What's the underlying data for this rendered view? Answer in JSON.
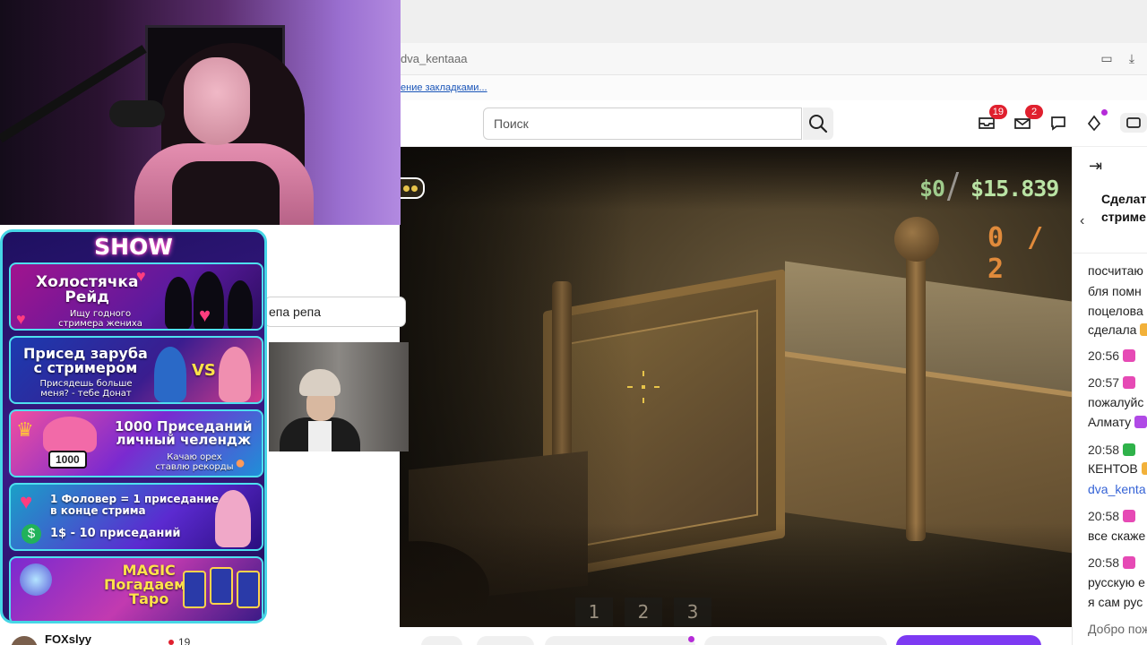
{
  "browser": {
    "address": "dva_kentaaa",
    "bookmarks_text": "ение закладками..."
  },
  "header": {
    "search_placeholder": "Поиск",
    "inbox_badge": "19",
    "messages_badge": "2"
  },
  "hud": {
    "money_current": "$0",
    "money_total": "$15.839",
    "ammo": "0 / 2",
    "slots": [
      "1",
      "2",
      "3"
    ]
  },
  "overlay": {
    "chat_input_value": "епа репа",
    "panel_title": "SHOW",
    "cards": [
      {
        "title": "Холостячка\nРейд",
        "sub": "Ищу годного\nстримера жениха"
      },
      {
        "title": "Присед заруба\nс стримером",
        "sub": "Присядешь больше\nменя? - тебе Донат",
        "vs": "VS"
      },
      {
        "title": "1000 Приседаний\nличный челендж",
        "sub": "Качаю орех\nставлю рекорды",
        "chip": "1000"
      },
      {
        "title": "1 Фоловер = 1 приседание\nв конце стрима",
        "sub2": "1$ - 10 приседаний"
      },
      {
        "title": "MAGIC\nПогадаем?\nТаро"
      }
    ],
    "streamer_name": "FOXslyy",
    "viewers": "19"
  },
  "chat": {
    "header_line1": "Сделат",
    "header_line2": "стриме",
    "messages": [
      {
        "time": "",
        "text": "посчитаю"
      },
      {
        "time": "",
        "text": "бля помн"
      },
      {
        "time": "",
        "text": "поцелова"
      },
      {
        "time": "",
        "text": "сделала"
      },
      {
        "time": "20:56",
        "text": ""
      },
      {
        "time": "20:57",
        "text": ""
      },
      {
        "time": "",
        "text": "пожалуйс"
      },
      {
        "time": "",
        "text": "Алмату"
      },
      {
        "time": "20:58",
        "text": ""
      },
      {
        "time": "",
        "text": "КЕНТОВ"
      },
      {
        "time": "",
        "text": "dva_kenta",
        "link": true
      },
      {
        "time": "20:58",
        "text": ""
      },
      {
        "time": "",
        "text": "все скаже"
      },
      {
        "time": "20:58",
        "text": ""
      },
      {
        "time": "",
        "text": "русскую е"
      },
      {
        "time": "",
        "text": "я сам рус"
      }
    ],
    "footer": "Добро пож"
  },
  "colors": {
    "accent_purple": "#7d3af2",
    "badge_red": "#e0202e",
    "panel_border": "#46d6e6",
    "hud_money": "#b9e3a4",
    "hud_ammo": "#e08a3b"
  }
}
